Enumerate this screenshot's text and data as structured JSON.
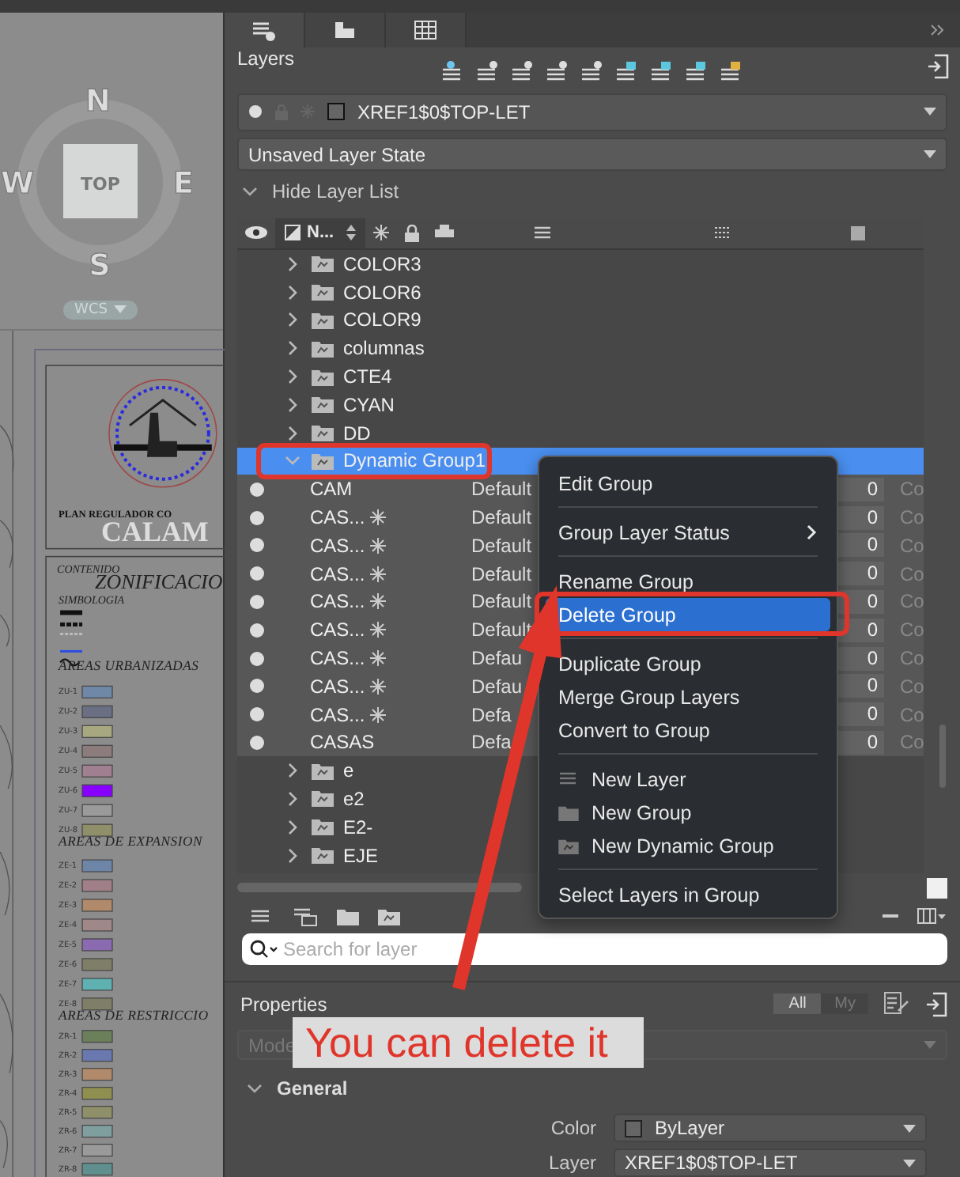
{
  "canvas": {
    "compass": {
      "north": "N",
      "west": "W",
      "east": "E",
      "south": "S",
      "center": "TOP"
    },
    "coordinate_system": "WCS",
    "title_block": {
      "subtitle": "PLAN REGULADOR CO",
      "title": "CALAM"
    },
    "legend": {
      "heading": "CONTENIDO",
      "title": "ZONIFICACIO",
      "symbology": "SIMBOLOGIA",
      "sections": [
        {
          "title": "AREAS URBANIZADAS",
          "items": [
            {
              "code": "ZU-1",
              "color": "#6f88a8"
            },
            {
              "code": "ZU-2",
              "color": "#6a6f84"
            },
            {
              "code": "ZU-3",
              "color": "#a8a880"
            },
            {
              "code": "ZU-4",
              "color": "#8c7c7c"
            },
            {
              "code": "ZU-5",
              "color": "#a07f90"
            },
            {
              "code": "ZU-6",
              "color": "#8800ff"
            },
            {
              "code": "ZU-7",
              "color": "#9a9a9a"
            },
            {
              "code": "ZU-8",
              "color": "#8f8f6a"
            }
          ]
        },
        {
          "title": "AREAS DE EXPANSION",
          "items": [
            {
              "code": "ZE-1",
              "color": "#6d86a8"
            },
            {
              "code": "ZE-2",
              "color": "#a07f88"
            },
            {
              "code": "ZE-3",
              "color": "#b08a6a"
            },
            {
              "code": "ZE-4",
              "color": "#a08888"
            },
            {
              "code": "ZE-5",
              "color": "#8a6ab0"
            },
            {
              "code": "ZE-6",
              "color": "#7f7f68"
            },
            {
              "code": "ZE-7",
              "color": "#5fb0b0"
            },
            {
              "code": "ZE-8",
              "color": "#7f7f68"
            }
          ]
        },
        {
          "title": "AREAS DE RESTRICCIO",
          "items": [
            {
              "code": "ZR-1",
              "color": "#6a7f5a"
            },
            {
              "code": "ZR-2",
              "color": "#6a78b0"
            },
            {
              "code": "ZR-3",
              "color": "#b08a6a"
            },
            {
              "code": "ZR-4",
              "color": "#8f8f50"
            },
            {
              "code": "ZR-5",
              "color": "#8f8f6a"
            },
            {
              "code": "ZR-6",
              "color": "#7f9f9f"
            },
            {
              "code": "ZR-7",
              "color": "#9a9a9a"
            },
            {
              "code": "ZR-8",
              "color": "#5f8f8f"
            }
          ]
        }
      ]
    }
  },
  "panel": {
    "tabs": [
      {
        "selected": true
      },
      {
        "selected": false
      },
      {
        "selected": false
      }
    ],
    "layers": {
      "title": "Layers",
      "current_layer": "XREF1$0$TOP-LET",
      "layer_state": "Unsaved Layer State",
      "list_toggle": {
        "label": "Hide Layer List",
        "expanded": true
      },
      "name_column": "N...",
      "rows": [
        {
          "kind": "group",
          "name": "COLOR3",
          "expanded": false,
          "selected": false
        },
        {
          "kind": "group",
          "name": "COLOR6",
          "expanded": false,
          "selected": false
        },
        {
          "kind": "group",
          "name": "COLOR9",
          "expanded": false,
          "selected": false
        },
        {
          "kind": "group",
          "name": "columnas",
          "expanded": false,
          "selected": false
        },
        {
          "kind": "group",
          "name": "CTE4",
          "expanded": false,
          "selected": false
        },
        {
          "kind": "group",
          "name": "CYAN",
          "expanded": false,
          "selected": false
        },
        {
          "kind": "group",
          "name": "DD",
          "expanded": false,
          "selected": false
        },
        {
          "kind": "group",
          "name": "Dynamic Group1",
          "expanded": true,
          "selected": true,
          "children": [
            {
              "kind": "layer",
              "name": "CAM",
              "frozen": false,
              "linetype": "Default",
              "lineweight": "0",
              "column_9": "Co",
              "selected": false
            },
            {
              "kind": "layer",
              "name": "CAS...",
              "frozen": true,
              "linetype": "Default",
              "lineweight": "0",
              "column_9": "Co",
              "selected": false
            },
            {
              "kind": "layer",
              "name": "CAS...",
              "frozen": true,
              "linetype": "Default",
              "lineweight": "0",
              "column_9": "Co",
              "selected": false
            },
            {
              "kind": "layer",
              "name": "CAS...",
              "frozen": true,
              "linetype": "Default",
              "lineweight": "0",
              "column_9": "Co",
              "selected": false
            },
            {
              "kind": "layer",
              "name": "CAS...",
              "frozen": true,
              "linetype": "Default",
              "lineweight": "0",
              "column_9": "Co",
              "selected": false
            },
            {
              "kind": "layer",
              "name": "CAS...",
              "frozen": true,
              "linetype": "Default",
              "lineweight": "0",
              "column_9": "Co",
              "selected": false
            },
            {
              "kind": "layer",
              "name": "CAS...",
              "frozen": true,
              "linetype": "Defau",
              "lineweight": "0",
              "column_9": "Co",
              "selected": false
            },
            {
              "kind": "layer",
              "name": "CAS...",
              "frozen": true,
              "linetype": "Defau",
              "lineweight": "0",
              "column_9": "Co",
              "selected": false
            },
            {
              "kind": "layer",
              "name": "CAS...",
              "frozen": true,
              "linetype": "Defa",
              "lineweight": "0",
              "column_9": "Co",
              "selected": false
            },
            {
              "kind": "layer",
              "name": "CASAS",
              "frozen": false,
              "linetype": "Defa",
              "lineweight": "0",
              "column_9": "Co",
              "selected": false
            }
          ]
        },
        {
          "kind": "group",
          "name": "e",
          "expanded": false,
          "selected": false
        },
        {
          "kind": "group",
          "name": "e2",
          "expanded": false,
          "selected": false
        },
        {
          "kind": "group",
          "name": "E2-",
          "expanded": false,
          "selected": false
        },
        {
          "kind": "group",
          "name": "EJE",
          "expanded": false,
          "selected": false
        }
      ],
      "search": {
        "placeholder": "Search for layer"
      }
    },
    "context_menu": {
      "sections": [
        {
          "items": [
            {
              "label": "Edit Group",
              "kind": "plain",
              "submenu": false,
              "selected": false
            }
          ]
        },
        {
          "items": [
            {
              "label": "Group Layer Status",
              "kind": "plain",
              "submenu": true,
              "selected": false
            }
          ]
        },
        {
          "items": [
            {
              "label": "Rename Group",
              "kind": "plain",
              "submenu": false,
              "selected": false
            },
            {
              "label": "Delete Group",
              "kind": "plain",
              "submenu": false,
              "selected": true
            }
          ]
        },
        {
          "items": [
            {
              "label": "Duplicate Group",
              "kind": "plain",
              "submenu": false,
              "selected": false
            },
            {
              "label": "Merge Group Layers",
              "kind": "plain",
              "submenu": false,
              "selected": false
            },
            {
              "label": "Convert to Group",
              "kind": "plain",
              "submenu": false,
              "selected": false
            }
          ]
        },
        {
          "items": [
            {
              "label": "New Layer",
              "kind": "layer",
              "submenu": false,
              "selected": false
            },
            {
              "label": "New Group",
              "kind": "group",
              "submenu": false,
              "selected": false
            },
            {
              "label": "New Dynamic Group",
              "kind": "dynamic_group",
              "submenu": false,
              "selected": false
            }
          ]
        },
        {
          "items": [
            {
              "label": "Select Layers in Group",
              "kind": "plain",
              "submenu": false,
              "selected": false
            }
          ]
        }
      ]
    },
    "properties": {
      "title": "Properties",
      "filters": [
        {
          "label": "All",
          "selected": true
        },
        {
          "label": "My",
          "selected": false
        }
      ],
      "space": "Mode",
      "section": {
        "title": "General",
        "expanded": true,
        "fields": [
          {
            "kind": "color",
            "label": "Color",
            "value": "ByLayer"
          },
          {
            "kind": "text",
            "label": "Layer",
            "value": "XREF1$0$TOP-LET"
          }
        ]
      }
    }
  },
  "annotation": {
    "callout": "You can delete it"
  }
}
